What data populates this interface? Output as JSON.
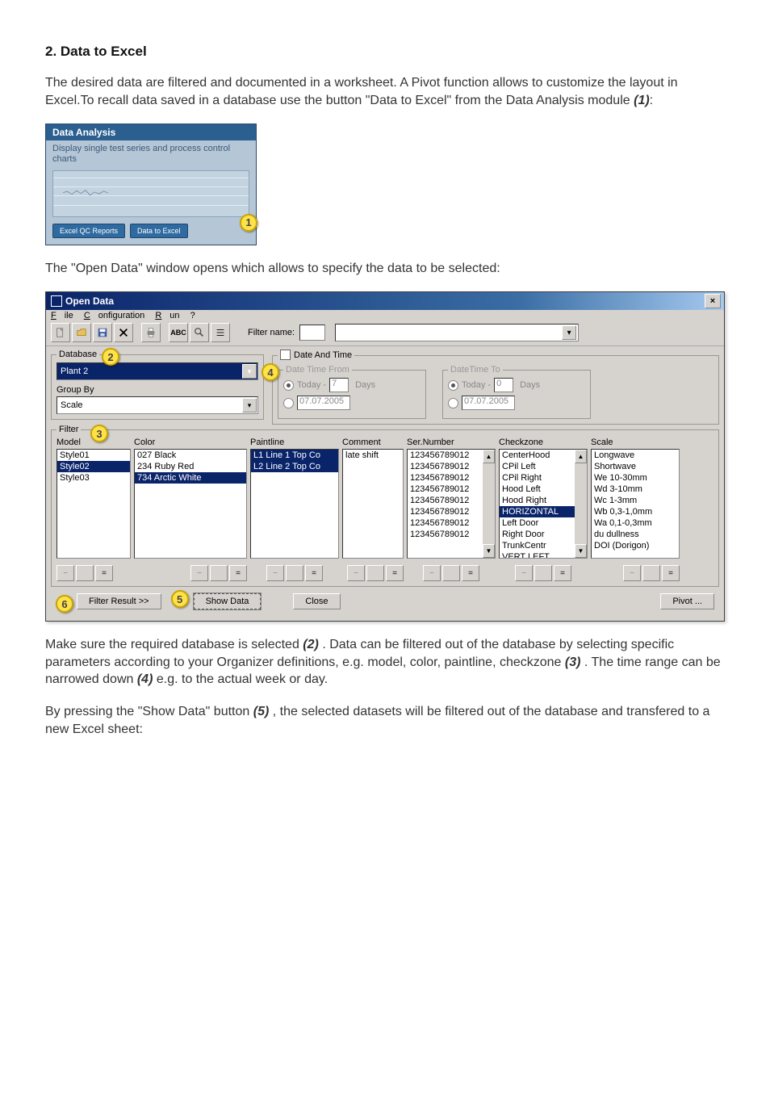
{
  "heading": "2. Data to Excel",
  "intro_html": [
    "The desired data are filtered and documented in a worksheet. A Pivot function allows to customize the layout in Excel.To recall data saved in a database use the button \"Data to Excel\" from the Data Analysis module ",
    "(1)",
    ":"
  ],
  "data_analysis_tile": {
    "title": "Data Analysis",
    "desc": "Display single test series and process control charts",
    "button_reports": "Excel QC Reports",
    "button_data_to_excel": "Data to Excel",
    "callout_1": "1"
  },
  "mid_paragraph": "The \"Open Data\" window opens which allows to specify the data to be selected:",
  "open_data": {
    "title": "Open Data",
    "close_x": "×",
    "menubar": {
      "file": "File",
      "file_u": "F",
      "config": "Configuration",
      "config_u": "C",
      "run": "Run",
      "run_u": "R",
      "help": "?"
    },
    "toolbar_abc": "ABC",
    "filter_name_label": "Filter name:",
    "database_legend": "Database",
    "database_value": "Plant 2",
    "groupby_label": "Group By",
    "groupby_value": "Scale",
    "datetime_legend": "Date And Time",
    "dtfrom_legend": "Date Time From",
    "dtto_legend": "DateTime To",
    "today_label": "Today -",
    "days_label": "Days",
    "from_days": "7",
    "to_days": "0",
    "date_sample": "07.07.2005",
    "callout_2": "2",
    "callout_3": "3",
    "callout_4": "4",
    "callout_5": "5",
    "callout_6": "6",
    "filter_legend": "Filter",
    "headers": [
      "Model",
      "Color",
      "Paintline",
      "Comment",
      "Ser.Number",
      "Checkzone",
      "Scale"
    ],
    "filter_nav": [
      "~",
      "",
      "="
    ],
    "model_list": [
      {
        "t": "Style01",
        "sel": false
      },
      {
        "t": "Style02",
        "sel": true
      },
      {
        "t": "Style03",
        "sel": false
      }
    ],
    "color_list": [
      {
        "t": "027 Black",
        "sel": false
      },
      {
        "t": "234 Ruby Red",
        "sel": false
      },
      {
        "t": "734 Arctic White",
        "sel": true
      }
    ],
    "paintline_list": [
      {
        "t": "L1 Line 1 Top Co",
        "sel": true
      },
      {
        "t": "L2 Line 2 Top Co",
        "sel": true
      }
    ],
    "comment_list": [
      {
        "t": "late shift",
        "sel": false
      }
    ],
    "sernumber_list": [
      {
        "t": "",
        "sel": true
      },
      {
        "t": "123456789012",
        "sel": false
      },
      {
        "t": "123456789012",
        "sel": false
      },
      {
        "t": "123456789012",
        "sel": false
      },
      {
        "t": "123456789012",
        "sel": false
      },
      {
        "t": "123456789012",
        "sel": false
      },
      {
        "t": "123456789012",
        "sel": false
      },
      {
        "t": "123456789012",
        "sel": false
      },
      {
        "t": "123456789012",
        "sel": false
      }
    ],
    "checkzone_list": [
      {
        "t": "CenterHood",
        "sel": false
      },
      {
        "t": "CPil Left",
        "sel": false
      },
      {
        "t": "CPil Right",
        "sel": false
      },
      {
        "t": "Hood Left",
        "sel": false
      },
      {
        "t": "Hood Right",
        "sel": false
      },
      {
        "t": "HORIZONTAL",
        "sel": true
      },
      {
        "t": "Left Door",
        "sel": false
      },
      {
        "t": "Right Door",
        "sel": false
      },
      {
        "t": "TrunkCentr",
        "sel": false
      },
      {
        "t": "VERT LEFT",
        "sel": false
      }
    ],
    "scale_list": [
      {
        "t": "Longwave",
        "sel": false
      },
      {
        "t": "Shortwave",
        "sel": false
      },
      {
        "t": "We 10-30mm",
        "sel": false
      },
      {
        "t": "Wd 3-10mm",
        "sel": false
      },
      {
        "t": "Wc 1-3mm",
        "sel": false
      },
      {
        "t": "Wb 0,3-1,0mm",
        "sel": false
      },
      {
        "t": "Wa 0,1-0,3mm",
        "sel": false
      },
      {
        "t": "du dullness",
        "sel": false
      },
      {
        "t": "DOI (Dorigon)",
        "sel": false
      }
    ],
    "filter_result": "Filter Result >>",
    "show_data": "Show Data",
    "close_btn": "Close",
    "pivot_btn": "Pivot ..."
  },
  "para_after_1": [
    "Make sure the required database is selected ",
    "(2)",
    ". Data can be filtered out of the database by selecting specific parameters according to your Organizer definitions, e.g. model, color, paintline, checkzone ",
    "(3)",
    ". The time range can be narrowed down ",
    "(4)",
    " e.g. to the actual week or day."
  ],
  "para_after_2": [
    "By pressing the \"Show Data\" button ",
    "(5)",
    ", the selected datasets will be filtered out of the database and transfered to a new Excel sheet:"
  ]
}
